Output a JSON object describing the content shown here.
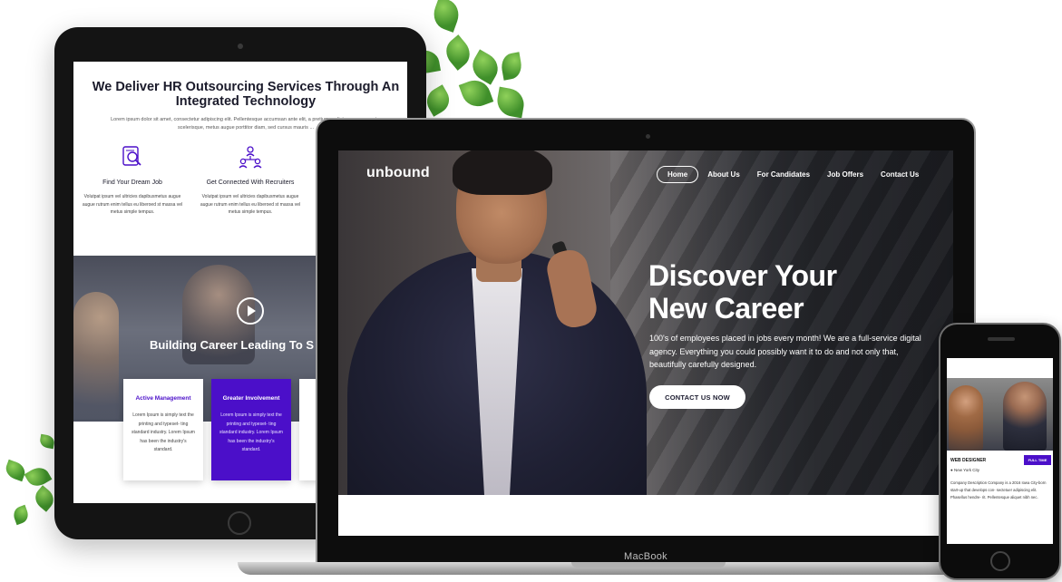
{
  "tablet": {
    "title": "We Deliver HR Outsourcing Services Through An Integrated Technology",
    "subtitle": "Lorem ipsum dolor sit amet, consectetur adipiscing elit. Pellentesque accumsan ante elit, a pretium ... dictum, ex eu auctor scelerisque, metus augue porttitor diam, sed cursus mauris ...",
    "features": [
      {
        "icon": "job-search-icon",
        "name": "Find Your Dream Job",
        "desc": "Volutpat ipsum vel ultricies dapibusmetus augue augue rutrum enim tellus eu liberoed st massa vel metus simple tempus."
      },
      {
        "icon": "team-network-icon",
        "name": "Get Connected With Recruiters",
        "desc": "Volutpat ipsum vel ultricies dapibusmetus augue augue rutrum enim tellus eu liberoed st massa vel metus simple tempus."
      }
    ],
    "hero_title": "Building Career Leading To S",
    "cards": [
      {
        "title": "Active Management",
        "body": "Lorem Ipsum is simply text the printing and typeset- ting standard industry. Lorem Ipsum has been the industry's standard."
      },
      {
        "title": "Greater Involvement",
        "body": "Lorem Ipsum is simply text the printing and typeset- ting standard industry. Lorem Ipsum has been the industry's standard."
      }
    ]
  },
  "laptop": {
    "label": "MacBook",
    "logo": "unbound",
    "nav": [
      "Home",
      "About Us",
      "For Candidates",
      "Job Offers",
      "Contact Us"
    ],
    "hero_title_line1": "Discover Your",
    "hero_title_line2": "New Career",
    "hero_desc": "100's of employees placed in jobs every month! We are a full-service digital agency. Everything you could possibly want it to do and not only that, beautifully carefully designed.",
    "cta": "CONTACT US NOW"
  },
  "phone": {
    "job_title": "WEB DESIGNER",
    "badge": "FULL TIME",
    "location": "New York City",
    "desc": "Company Description Company is a 2016 Iowa City-born start-up that develops con- sectetuer adipiscing elit. Phasellus hendre- rit. Pellentesque aliquet nibh nec."
  },
  "colors": {
    "accent_purple": "#4b0fc9",
    "dark_text": "#1b1b2b",
    "leaf_green": "#4f9a33"
  }
}
